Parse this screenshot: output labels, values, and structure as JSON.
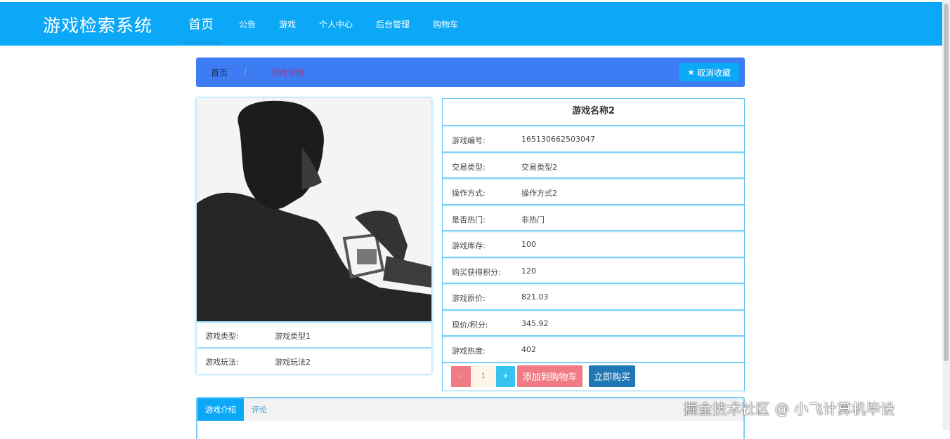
{
  "header": {
    "brand": "游戏检索系统",
    "nav": [
      "首页",
      "公告",
      "游戏",
      "个人中心",
      "后台管理",
      "购物车"
    ]
  },
  "breadcrumb": {
    "home": "首页",
    "separator": "/",
    "current": "游戏详情",
    "favorite_label": "取消收藏"
  },
  "left_details": [
    {
      "key": "游戏类型:",
      "value": "游戏类型1"
    },
    {
      "key": "游戏玩法:",
      "value": "游戏玩法2"
    }
  ],
  "detail": {
    "title": "游戏名称2",
    "rows": [
      {
        "key": "游戏编号:",
        "value": "165130662503047"
      },
      {
        "key": "交易类型:",
        "value": "交易类型2"
      },
      {
        "key": "操作方式:",
        "value": "操作方式2"
      },
      {
        "key": "是否热门:",
        "value": "非热门"
      },
      {
        "key": "游戏库存:",
        "value": "100"
      },
      {
        "key": "购买获得积分:",
        "value": "120"
      },
      {
        "key": "游戏原价:",
        "value": "821.03"
      },
      {
        "key": "现价/积分:",
        "value": "345.92"
      },
      {
        "key": "游戏热度:",
        "value": "402"
      }
    ],
    "quantity": "1",
    "minus": "-",
    "plus": "+",
    "add_to_cart": "添加到购物车",
    "buy_now": "立即购买"
  },
  "tabs": [
    "游戏介绍",
    "评论"
  ],
  "watermark": "掘金技术社区 @ 小飞计算机毕设",
  "colors": {
    "primary": "#0ba8f7",
    "breadcrumb_bg": "#3d7cf2",
    "danger": "#f07b84",
    "dark_button": "#1f77b4"
  }
}
